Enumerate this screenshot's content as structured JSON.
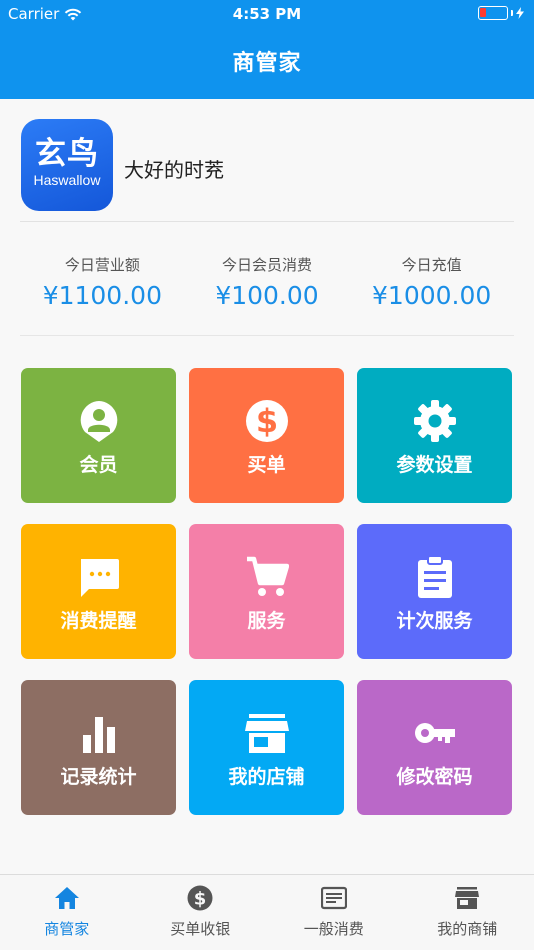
{
  "status_bar": {
    "carrier": "Carrier",
    "time": "4:53 PM"
  },
  "nav": {
    "title": "商管家"
  },
  "profile": {
    "logo_text": "玄鸟",
    "logo_subtext": "Haswallow",
    "shop_name": "大好的时茺"
  },
  "stats": [
    {
      "label": "今日营业额",
      "value": "¥1100.00"
    },
    {
      "label": "今日会员消费",
      "value": "¥100.00"
    },
    {
      "label": "今日充值",
      "value": "¥1000.00"
    }
  ],
  "tiles": [
    {
      "label": "会员",
      "icon": "member-icon",
      "color": "#7cb342"
    },
    {
      "label": "买单",
      "icon": "dollar-icon",
      "color": "#ff7043"
    },
    {
      "label": "参数设置",
      "icon": "gear-icon",
      "color": "#00acc1"
    },
    {
      "label": "消费提醒",
      "icon": "message-icon",
      "color": "#ffb300"
    },
    {
      "label": "服务",
      "icon": "cart-icon",
      "color": "#f47fa8"
    },
    {
      "label": "计次服务",
      "icon": "clipboard-icon",
      "color": "#5c6bfa"
    },
    {
      "label": "记录统计",
      "icon": "bar-chart-icon",
      "color": "#8d6e63"
    },
    {
      "label": "我的店铺",
      "icon": "store-icon",
      "color": "#03a9f4"
    },
    {
      "label": "修改密码",
      "icon": "key-icon",
      "color": "#ba68c8"
    }
  ],
  "tabs": [
    {
      "label": "商管家",
      "icon": "home-icon",
      "active": true
    },
    {
      "label": "买单收银",
      "icon": "dollar-icon",
      "active": false
    },
    {
      "label": "一般消费",
      "icon": "receipt-icon",
      "active": false
    },
    {
      "label": "我的商铺",
      "icon": "store-icon",
      "active": false
    }
  ],
  "colors": {
    "nav_bg": "#0f93ee",
    "accent": "#1a8ee6",
    "tab_active": "#1485e0"
  }
}
